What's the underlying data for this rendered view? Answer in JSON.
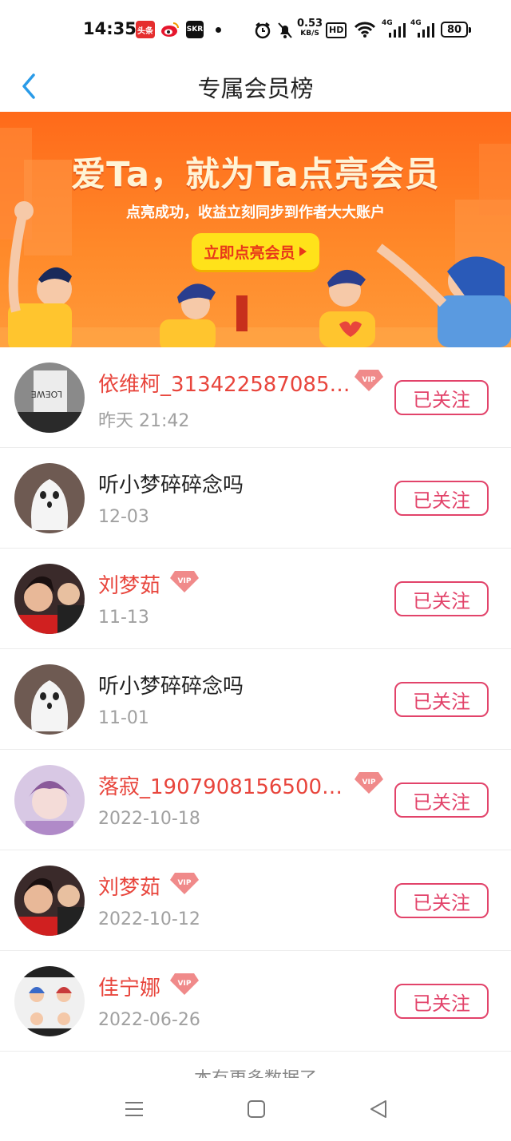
{
  "status_bar": {
    "time": "14:35",
    "toutiao": "头条",
    "skr": "SKR",
    "speed_value": "0.53",
    "speed_unit": "KB/S",
    "hd": "HD",
    "net1": "4G",
    "net2": "4G",
    "battery": "80"
  },
  "nav": {
    "title": "专属会员榜"
  },
  "banner": {
    "title": "爱Ta，就为Ta点亮会员",
    "subtitle": "点亮成功，收益立刻同步到作者大大账户",
    "cta": "立即点亮会员"
  },
  "members": [
    {
      "name": "依维柯_3134225870853...",
      "date": "昨天 21:42",
      "vip": true,
      "button": "已关注"
    },
    {
      "name": "听小梦碎碎念吗",
      "date": "12-03",
      "vip": false,
      "button": "已关注"
    },
    {
      "name": "刘梦茹",
      "date": "11-13",
      "vip": true,
      "button": "已关注"
    },
    {
      "name": "听小梦碎碎念吗",
      "date": "11-01",
      "vip": false,
      "button": "已关注"
    },
    {
      "name": "落寂_19079081565003...",
      "date": "2022-10-18",
      "vip": true,
      "button": "已关注"
    },
    {
      "name": "刘梦茹",
      "date": "2022-10-12",
      "vip": true,
      "button": "已关注"
    },
    {
      "name": "佳宁娜",
      "date": "2022-06-26",
      "vip": true,
      "button": "已关注"
    }
  ],
  "vip_label": "VIP",
  "footer": {
    "no_more": "本有更多数据了"
  },
  "colors": {
    "vip_name": "#e8453c",
    "follow_border": "#e2436a",
    "banner_orange": "#ff7a22",
    "cta_yellow": "#ffe21a",
    "back_arrow": "#2a9be8"
  }
}
